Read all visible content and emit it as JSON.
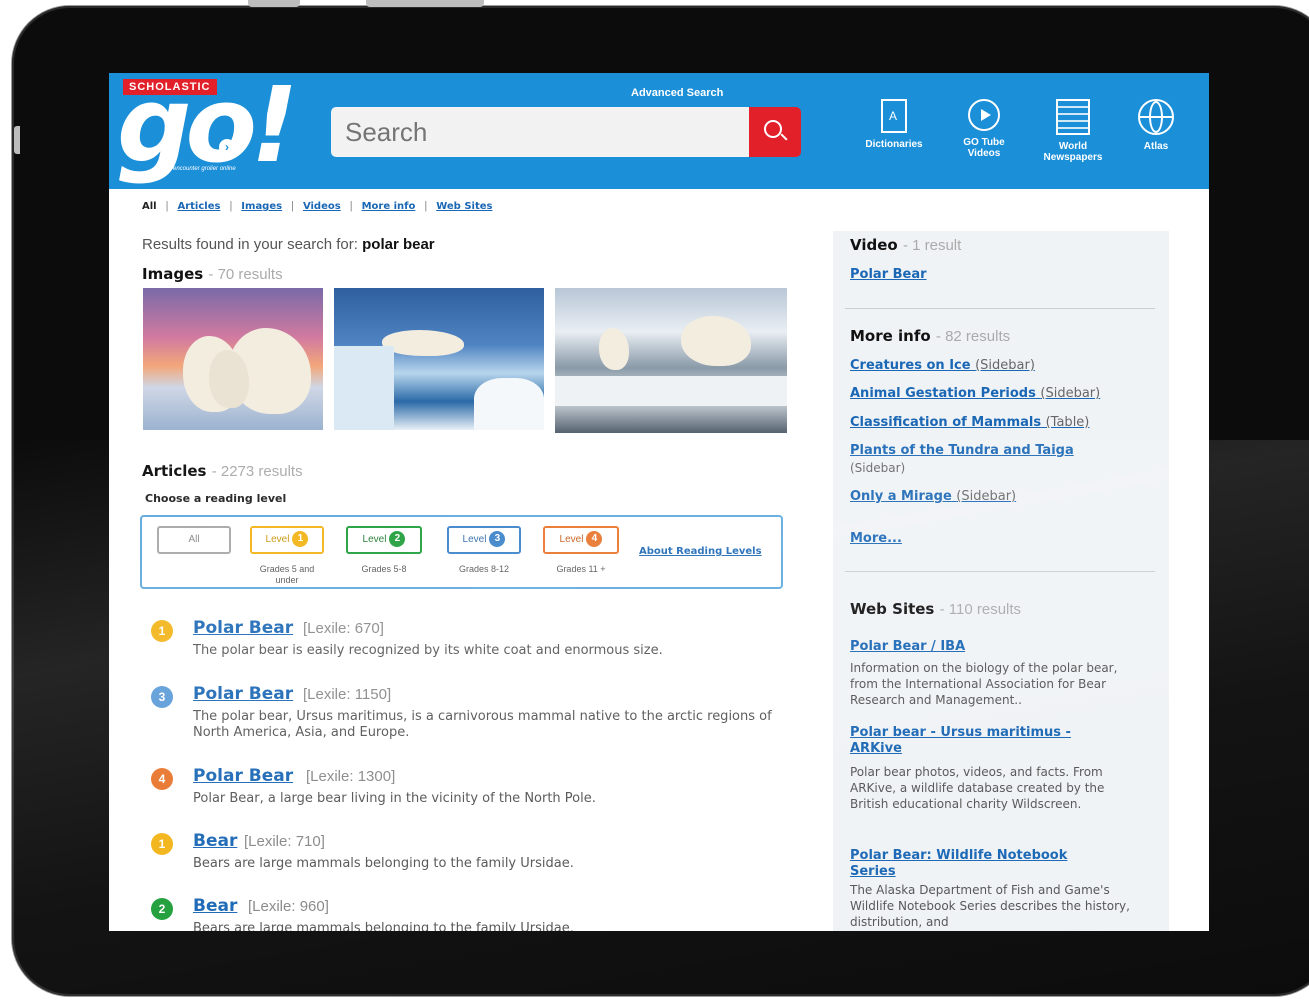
{
  "header": {
    "brand": "SCHOLASTIC",
    "logo": "go!",
    "tagline": "encounter grolier online",
    "advanced_search": "Advanced Search",
    "search_placeholder": "Search",
    "tools": [
      {
        "label": "Dictionaries",
        "icon": "dictionary-icon"
      },
      {
        "label": "GO Tube Videos",
        "icon": "video-play-icon"
      },
      {
        "label": "World Newspapers",
        "icon": "newspaper-icon"
      },
      {
        "label": "Atlas",
        "icon": "globe-icon"
      }
    ]
  },
  "filters": {
    "all": "All",
    "articles": "Articles",
    "images": "Images",
    "videos": "Videos",
    "more_info": "More info",
    "web_sites": "Web Sites"
  },
  "results": {
    "prefix": "Results found in your search for:",
    "query": "polar bear"
  },
  "images_section": {
    "title": "Images",
    "count": "- 70 results"
  },
  "articles_section": {
    "title": "Articles",
    "count": "- 2273 results",
    "reading_label": "Choose a reading level",
    "levels": [
      {
        "label": "All",
        "grade": ""
      },
      {
        "label": "Level",
        "num": "1",
        "grade": "Grades 5 and under",
        "color": "#f2b416"
      },
      {
        "label": "Level",
        "num": "2",
        "grade": "Grades 5-8",
        "color": "#1f9e3a"
      },
      {
        "label": "Level",
        "num": "3",
        "grade": "Grades 8-12",
        "color": "#3b82c8"
      },
      {
        "label": "Level",
        "num": "4",
        "grade": "Grades 11 +",
        "color": "#e8742a"
      }
    ],
    "about_levels": "About Reading Levels",
    "items": [
      {
        "level": "1",
        "color": "#f2b416",
        "title": "Polar Bear",
        "lexile": "[Lexile: 670]",
        "desc": "The polar bear is easily recognized by its white coat and enormous size."
      },
      {
        "level": "3",
        "color": "#5a9bd8",
        "title": "Polar Bear",
        "lexile": "[Lexile: 1150]",
        "desc": "The polar bear, Ursus maritimus, is a carnivorous mammal native to the arctic regions of North America, Asia, and Europe."
      },
      {
        "level": "4",
        "color": "#e8742a",
        "title": "Polar Bear",
        "lexile": "[Lexile: 1300]",
        "desc": "Polar Bear, a large bear living in the vicinity of the North Pole."
      },
      {
        "level": "1",
        "color": "#f2b416",
        "title": "Bear",
        "lexile": "[Lexile: 710]",
        "desc": "Bears are large mammals belonging to the family Ursidae."
      },
      {
        "level": "2",
        "color": "#1f9e3a",
        "title": "Bear",
        "lexile": "[Lexile: 960]",
        "desc": "Bears are large mammals belonging to the family Ursidae."
      }
    ]
  },
  "sidebar": {
    "video": {
      "title": "Video",
      "count": "- 1 result",
      "link": "Polar Bear"
    },
    "more_info": {
      "title": "More info",
      "count": "- 82 results",
      "links": [
        {
          "label": "Creatures on Ice",
          "tag": "(Sidebar)"
        },
        {
          "label": "Animal Gestation Periods",
          "tag": "(Sidebar)"
        },
        {
          "label": "Classification of Mammals",
          "tag": "(Table)"
        },
        {
          "label": "Plants of the Tundra and Taiga",
          "tag": "(Sidebar)"
        },
        {
          "label": "Only a Mirage",
          "tag": "(Sidebar)"
        }
      ],
      "more": "More..."
    },
    "web_sites": {
      "title": "Web Sites",
      "count": "- 110 results",
      "items": [
        {
          "title": "Polar Bear / IBA",
          "desc": "Information on the biology of the polar bear, from the International Association for Bear Research and Management.."
        },
        {
          "title": "Polar bear - Ursus maritimus - ARKive",
          "desc": "Polar bear photos, videos, and facts. From ARKive, a wildlife database created by the British educational charity Wildscreen."
        },
        {
          "title": "Polar Bear: Wildlife Notebook Series",
          "desc": "The Alaska Department of Fish and Game's Wildlife Notebook Series describes the history, distribution, and"
        }
      ]
    }
  }
}
